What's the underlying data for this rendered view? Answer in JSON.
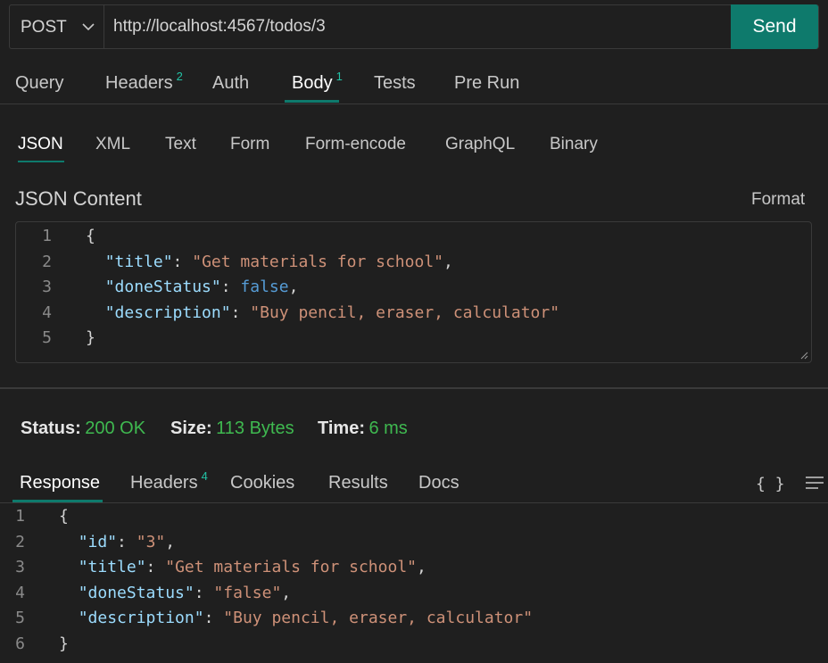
{
  "request": {
    "method": "POST",
    "url": "http://localhost:4567/todos/3",
    "send_label": "Send"
  },
  "request_tabs": [
    {
      "label": "Query",
      "badge": ""
    },
    {
      "label": "Headers",
      "badge": "2"
    },
    {
      "label": "Auth",
      "badge": ""
    },
    {
      "label": "Body",
      "badge": "1"
    },
    {
      "label": "Tests",
      "badge": ""
    },
    {
      "label": "Pre Run",
      "badge": ""
    }
  ],
  "active_request_tab": "Body",
  "body_tabs": [
    "JSON",
    "XML",
    "Text",
    "Form",
    "Form-encode",
    "GraphQL",
    "Binary"
  ],
  "active_body_tab": "JSON",
  "json_section": {
    "title": "JSON Content",
    "format_label": "Format"
  },
  "request_body_lines": [
    {
      "n": "1",
      "text": "{"
    },
    {
      "n": "2",
      "text": "  \"title\": \"Get materials for school\","
    },
    {
      "n": "3",
      "text": "  \"doneStatus\": false,"
    },
    {
      "n": "4",
      "text": "  \"description\": \"Buy pencil, eraser, calculator\""
    },
    {
      "n": "5",
      "text": "}"
    }
  ],
  "status": {
    "status_label": "Status:",
    "status_value": "200 OK",
    "size_label": "Size:",
    "size_value": "113 Bytes",
    "time_label": "Time:",
    "time_value": "6 ms"
  },
  "response_tabs": [
    {
      "label": "Response",
      "badge": ""
    },
    {
      "label": "Headers",
      "badge": "4"
    },
    {
      "label": "Cookies",
      "badge": ""
    },
    {
      "label": "Results",
      "badge": ""
    },
    {
      "label": "Docs",
      "badge": ""
    }
  ],
  "active_response_tab": "Response",
  "response_icons": {
    "braces": "{ }",
    "menu": "menu-icon"
  },
  "response_body_lines": [
    {
      "n": "1",
      "text": "{"
    },
    {
      "n": "2",
      "text": "  \"id\": \"3\","
    },
    {
      "n": "3",
      "text": "  \"title\": \"Get materials for school\","
    },
    {
      "n": "4",
      "text": "  \"doneStatus\": \"false\","
    },
    {
      "n": "5",
      "text": "  \"description\": \"Buy pencil, eraser, calculator\""
    },
    {
      "n": "6",
      "text": "}"
    }
  ],
  "colors": {
    "accent": "#0e7a6c",
    "badge": "#22c3a6",
    "status_ok": "#3fb950",
    "json_key": "#9cdcfe",
    "json_string": "#ce9178",
    "json_bool": "#569cd6"
  }
}
